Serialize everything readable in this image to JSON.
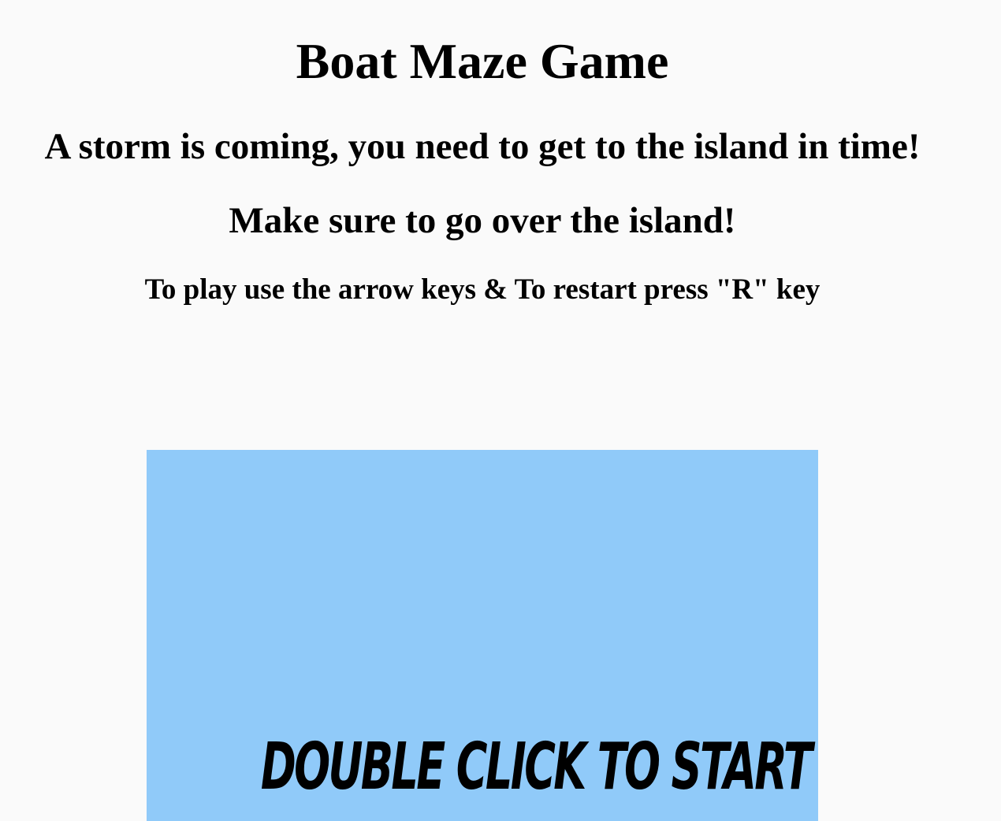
{
  "header": {
    "title": "Boat Maze Game",
    "subtitle": "A storm is coming, you need to get to the island in time!",
    "hint": "Make sure to go over the island!",
    "instructions": "To play use the arrow keys & To restart press \"R\" key"
  },
  "game": {
    "start_prompt": "DOUBLE CLICK TO START",
    "canvas_color": "#90caf9"
  }
}
